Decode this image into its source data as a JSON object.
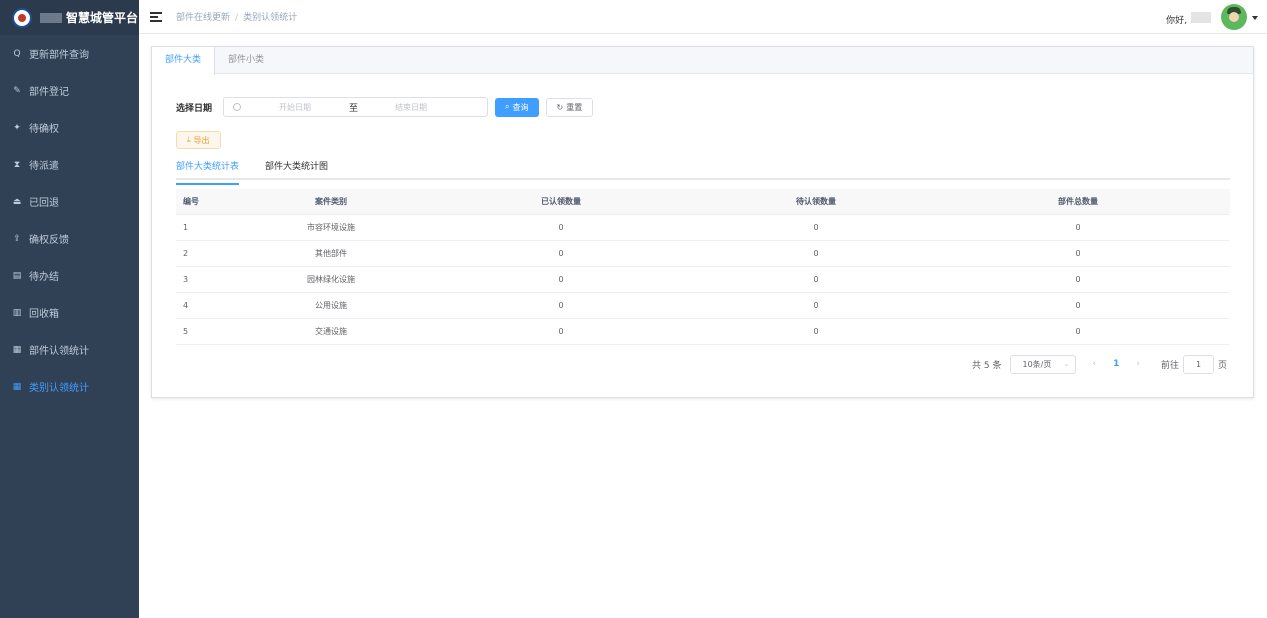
{
  "brand": {
    "title": "智慧城管平台"
  },
  "sidebar": {
    "items": [
      {
        "label": "更新部件查询",
        "icon": "Q"
      },
      {
        "label": "部件登记",
        "icon": "✎"
      },
      {
        "label": "待确权",
        "icon": "✦"
      },
      {
        "label": "待派遣",
        "icon": "⧗"
      },
      {
        "label": "已回退",
        "icon": "⏏"
      },
      {
        "label": "确权反馈",
        "icon": "⇪"
      },
      {
        "label": "待办结",
        "icon": "▤"
      },
      {
        "label": "回收箱",
        "icon": "▥"
      },
      {
        "label": "部件认领统计",
        "icon": "▦"
      },
      {
        "label": "类别认领统计",
        "icon": "▦"
      }
    ]
  },
  "header": {
    "breadcrumb": [
      "部件在线更新",
      "类别认领统计"
    ],
    "greeting": "你好,"
  },
  "tabs": [
    "部件大类",
    "部件小类"
  ],
  "filter": {
    "label": "选择日期",
    "start_placeholder": "开始日期",
    "separator": "至",
    "end_placeholder": "结束日期",
    "query_label": "查询",
    "reset_label": "重置"
  },
  "export_label": "导出",
  "subtabs": [
    "部件大类统计表",
    "部件大类统计图"
  ],
  "table": {
    "headers": [
      "编号",
      "案件类别",
      "已认领数量",
      "待认领数量",
      "部件总数量"
    ],
    "rows": [
      [
        "1",
        "市容环境设施",
        "0",
        "0",
        "0"
      ],
      [
        "2",
        "其他部件",
        "0",
        "0",
        "0"
      ],
      [
        "3",
        "园林绿化设施",
        "0",
        "0",
        "0"
      ],
      [
        "4",
        "公用设施",
        "0",
        "0",
        "0"
      ],
      [
        "5",
        "交通设施",
        "0",
        "0",
        "0"
      ]
    ]
  },
  "pagination": {
    "total": "共 5 条",
    "page_size": "10条/页",
    "current": "1",
    "goto_label": "前往",
    "goto_value": "1",
    "page_suffix": "页"
  },
  "colors": {
    "sidebar_bg": "#304156",
    "accent": "#409eff",
    "warning": "#e6a23c"
  }
}
